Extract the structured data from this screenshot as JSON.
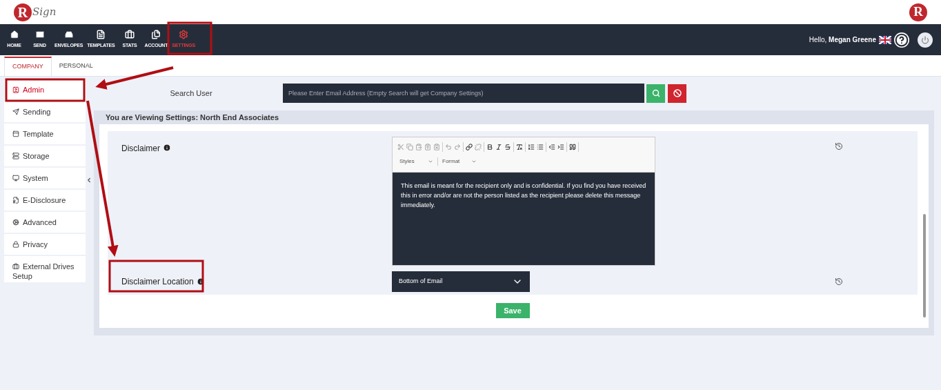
{
  "logo": {
    "letter": "R",
    "word": "Sign"
  },
  "brand_mark": "R",
  "nav": [
    {
      "label": "HOME",
      "selected": false
    },
    {
      "label": "SEND",
      "selected": false
    },
    {
      "label": "ENVELOPES",
      "selected": false
    },
    {
      "label": "TEMPLATES",
      "selected": false
    },
    {
      "label": "STATS",
      "selected": false
    },
    {
      "label": "ACCOUNT",
      "selected": false
    },
    {
      "label": "SETTINGS",
      "selected": true
    }
  ],
  "user": {
    "greeting": "Hello,",
    "name": "Megan Greene"
  },
  "tabs": [
    {
      "label": "COMPANY",
      "selected": true
    },
    {
      "label": "PERSONAL",
      "selected": false
    }
  ],
  "sidebar": {
    "items": [
      {
        "label": "Admin",
        "selected": true
      },
      {
        "label": "Sending",
        "selected": false
      },
      {
        "label": "Template",
        "selected": false
      },
      {
        "label": "Storage",
        "selected": false
      },
      {
        "label": "System",
        "selected": false
      },
      {
        "label": "E-Disclosure",
        "selected": false
      },
      {
        "label": "Advanced",
        "selected": false
      },
      {
        "label": "Privacy",
        "selected": false
      },
      {
        "label": "External Drives Setup",
        "selected": false
      }
    ]
  },
  "search": {
    "label": "Search User",
    "placeholder": "Please Enter Email Address (Empty Search will get Company Settings)"
  },
  "panel": {
    "title": "You are Viewing Settings: North End Associates",
    "rows": [
      {
        "kind": "editor",
        "label": "Disclaimer",
        "dropdowns": [
          "Styles",
          "Format"
        ],
        "value": "This email is meant for the recipient only and is confidential. If you find you have received this in error and/or are not the person listed as the recipient please delete this message immediately."
      },
      {
        "kind": "select",
        "label": "Disclaimer Location",
        "value": "Bottom of Email"
      }
    ],
    "save": "Save"
  }
}
